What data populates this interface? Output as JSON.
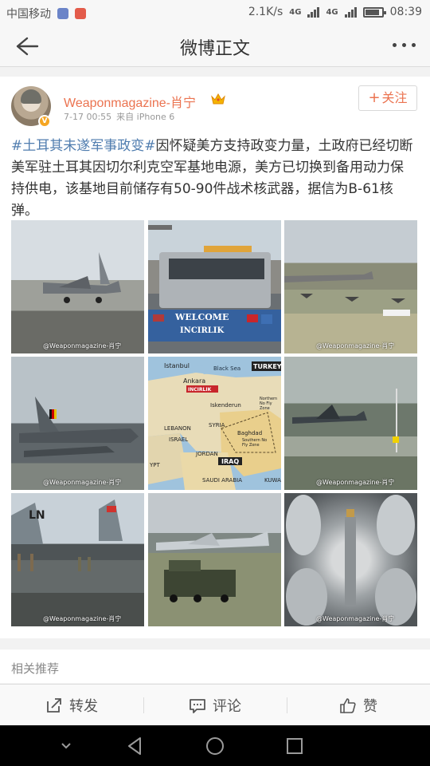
{
  "status_bar": {
    "carrier": "中国移动",
    "speed": "2.1K/s",
    "network": "4G",
    "network2": "4G",
    "time": "08:39",
    "battery_level": 0.85
  },
  "title_bar": {
    "back_icon": "arrow-left-icon",
    "title": "微博正文",
    "more_icon": "more-dots-icon"
  },
  "post": {
    "username": "Weaponmagazine-肖宁",
    "verified_badge": "V",
    "member_icon": "crown-icon",
    "time": "7-17 00:55",
    "device": "来自 iPhone 6",
    "follow_label": "关注",
    "follow_plus": "+",
    "topic": "#土耳其未遂军事政变#",
    "body": "因怀疑美方支持政变力量，土政府已经切断美军驻土耳其因切尔利克空军基地电源，美方已切换到备用动力保持供电，该基地目前储存有50-90件战术核武器，据信为B-61核弹。",
    "watermark": "@Weaponmagazine-肖宁",
    "images": [
      {
        "subject": "f16-fighter-jet-on-runway"
      },
      {
        "subject": "incirlik-welcome-truck",
        "text1": "WELCOME",
        "text2": "INCIRLIK"
      },
      {
        "subject": "airbase-aircraft-on-tarmac"
      },
      {
        "subject": "tornado-jets-on-flightline"
      },
      {
        "subject": "turkey-iraq-map",
        "labels": {
          "istanbul": "Istanbul",
          "black_sea": "Black Sea",
          "turkey": "TURKEY",
          "ankara": "Ankara",
          "incirlik": "INCIRLIK",
          "iskenderun": "Iskenderun",
          "lebanon": "LEBANON",
          "syria": "SYRIA",
          "israel": "ISRAEL",
          "jordan": "JORDAN",
          "baghdad": "Baghdad",
          "iraq": "IRAQ",
          "saudi": "SAUDI ARABIA",
          "kuwait": "KUWA",
          "egypt": "YPT",
          "northern_zone": "Northern No Fly Zone",
          "southern_zone": "Southern No Fly Zone"
        }
      },
      {
        "subject": "c17-transport-on-runway"
      },
      {
        "subject": "f15-jets-with-personnel",
        "text": "LN"
      },
      {
        "subject": "kc135-tanker-and-truck"
      },
      {
        "subject": "b61-nuclear-bombs-closeup"
      }
    ]
  },
  "related": {
    "label": "相关推荐"
  },
  "actions": [
    {
      "icon": "share-icon",
      "label": "转发"
    },
    {
      "icon": "comment-icon",
      "label": "评论"
    },
    {
      "icon": "thumbs-up-icon",
      "label": "赞"
    }
  ],
  "nav_bar": {
    "down_icon": "chevron-down-icon",
    "back_icon": "triangle-back-icon",
    "home_icon": "circle-home-icon",
    "recent_icon": "square-recent-icon"
  }
}
